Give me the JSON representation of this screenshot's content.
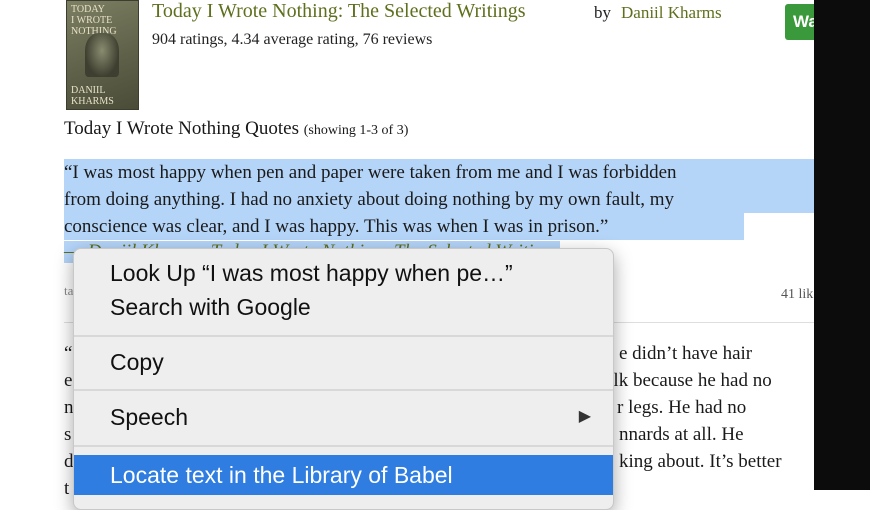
{
  "book": {
    "cover_lines": [
      "TODAY",
      "I WROTE",
      "NOTHING",
      "DANIIL",
      "KHARMS"
    ],
    "title": "Today I Wrote Nothing: The Selected Writings",
    "by": "by",
    "author": "Daniil Kharms",
    "stats": "904 ratings, 4.34 average rating, 76 reviews",
    "want_button_partial": "Wa"
  },
  "quotes": {
    "heading": "Today I Wrote Nothing Quotes",
    "showing": "(showing 1-3 of 3)",
    "first_quote_lines": [
      "“I was most happy when pen and paper were taken from me and I was forbidden",
      "from doing anything. I had no anxiety about doing nothing by my own fault, my",
      "conscience was clear, and I was happy. This was when I was in prison.”"
    ],
    "attribution": "― Daniil Kharms, Today I Wrote Nothing: The Selected Writings",
    "meta_partial": "ta",
    "likes_partial": "41 lik",
    "second_quote_fragments": [
      {
        "left": "“",
        "right": "e didn’t have hair"
      },
      {
        "left": "e",
        "right": "alk because he had no"
      },
      {
        "left": "n",
        "right": "r legs. He had no"
      },
      {
        "left": "s",
        "right": "nnards at all. He"
      },
      {
        "left": "d",
        "right": "king about. It’s better"
      },
      {
        "left": "t",
        "right": ""
      }
    ]
  },
  "context_menu": {
    "items": [
      {
        "label": "Look Up “I was most happy when pe…”"
      },
      {
        "label": "Search with Google"
      },
      {
        "label": "Copy"
      },
      {
        "label": "Speech",
        "submenu_arrow": "▶"
      },
      {
        "label": "Locate text in the Library of Babel"
      }
    ]
  },
  "colors": {
    "link_green": "#5e6f1d",
    "selection": "#b4d4f8",
    "menu_highlight": "#2f7de1",
    "want_button": "#3a9a3b"
  }
}
